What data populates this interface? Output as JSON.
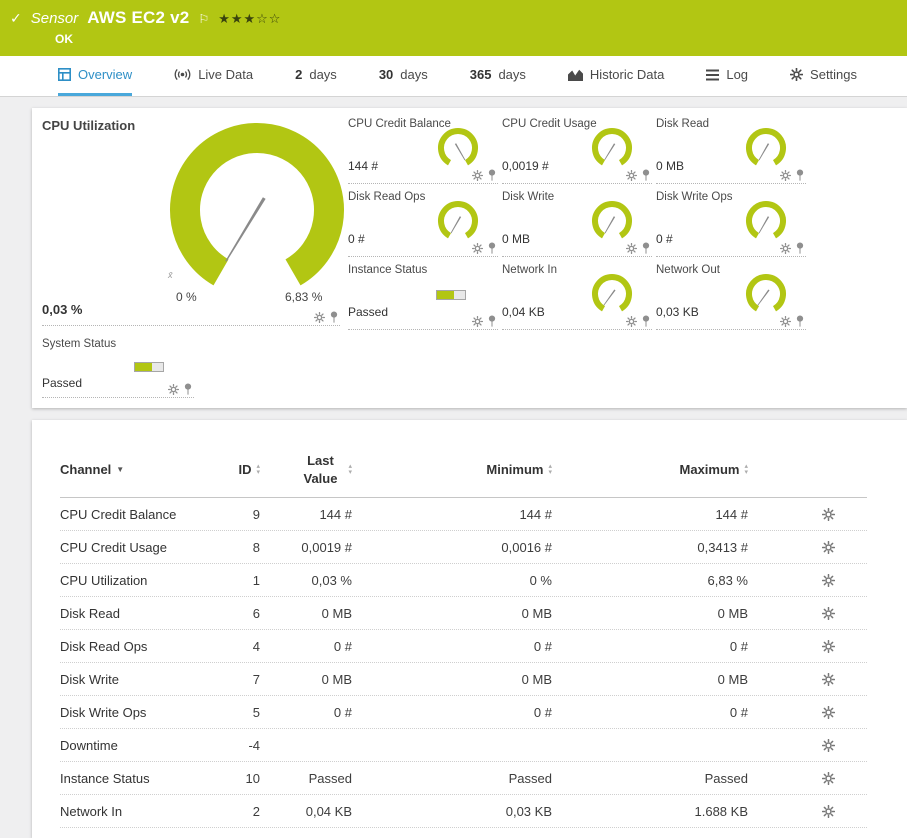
{
  "colors": {
    "green": "#b2c613",
    "green-dark": "#39430e",
    "blue": "#2e8fc6",
    "blue-underline": "#49a8db"
  },
  "icons": {
    "check": "✓",
    "flag": "⚐",
    "sort_desc": "▼",
    "sort_up": "▴",
    "sort_down": "▾"
  },
  "header": {
    "kind_label": "Sensor",
    "title": "AWS EC2 v2",
    "status": "OK",
    "stars_filled": "★★★",
    "stars_empty": "☆☆"
  },
  "tabs": [
    {
      "key": "overview",
      "icon": "overview",
      "label": "Overview",
      "active": true
    },
    {
      "key": "live-data",
      "icon": "livedata",
      "label": "Live Data"
    },
    {
      "key": "2-days",
      "num": "2",
      "label": "days"
    },
    {
      "key": "30-days",
      "num": "30",
      "label": "days"
    },
    {
      "key": "365-days",
      "num": "365",
      "label": "days"
    },
    {
      "key": "historic-data",
      "icon": "historic",
      "label": "Historic Data"
    },
    {
      "key": "log",
      "icon": "log",
      "label": "Log"
    },
    {
      "key": "settings",
      "icon": "settings",
      "label": "Settings"
    }
  ],
  "overview": {
    "main_gauge": {
      "label": "CPU Utilization",
      "value": "0,03 %",
      "min": "0 %",
      "max": "6,83 %",
      "mean_marker": "x̄",
      "needle_fraction": 0.004
    },
    "small_gauges": [
      {
        "label": "CPU Credit Balance",
        "value": "144 #",
        "type": "gauge",
        "needle_fraction": 1
      },
      {
        "label": "CPU Credit Usage",
        "value": "0,0019 #",
        "type": "gauge",
        "needle_fraction": 0.006
      },
      {
        "label": "Disk Read",
        "value": "0 MB",
        "type": "gauge",
        "needle_fraction": 0
      },
      {
        "label": "Disk Read Ops",
        "value": "0 #",
        "type": "gauge",
        "needle_fraction": 0
      },
      {
        "label": "Disk Write",
        "value": "0 MB",
        "type": "gauge",
        "needle_fraction": 0
      },
      {
        "label": "Disk Write Ops",
        "value": "0 #",
        "type": "gauge",
        "needle_fraction": 0
      },
      {
        "label": "Instance Status",
        "value": "Passed",
        "type": "status"
      },
      {
        "label": "Network In",
        "value": "0,04 KB",
        "type": "gauge",
        "needle_fraction": 0.02
      },
      {
        "label": "Network Out",
        "value": "0,03 KB",
        "type": "gauge",
        "needle_fraction": 0.02
      }
    ],
    "system_status": {
      "label": "System Status",
      "value": "Passed",
      "type": "status"
    }
  },
  "table": {
    "headers": {
      "channel": "Channel",
      "id": "ID",
      "last": "Last Value",
      "min": "Minimum",
      "max": "Maximum"
    },
    "rows": [
      {
        "channel": "CPU Credit Balance",
        "id": "9",
        "last": "144 #",
        "min": "144 #",
        "max": "144 #"
      },
      {
        "channel": "CPU Credit Usage",
        "id": "8",
        "last": "0,0019 #",
        "min": "0,0016 #",
        "max": "0,3413 #"
      },
      {
        "channel": "CPU Utilization",
        "id": "1",
        "last": "0,03 %",
        "min": "0 %",
        "max": "6,83 %"
      },
      {
        "channel": "Disk Read",
        "id": "6",
        "last": "0 MB",
        "min": "0 MB",
        "max": "0 MB"
      },
      {
        "channel": "Disk Read Ops",
        "id": "4",
        "last": "0 #",
        "min": "0 #",
        "max": "0 #"
      },
      {
        "channel": "Disk Write",
        "id": "7",
        "last": "0 MB",
        "min": "0 MB",
        "max": "0 MB"
      },
      {
        "channel": "Disk Write Ops",
        "id": "5",
        "last": "0 #",
        "min": "0 #",
        "max": "0 #"
      },
      {
        "channel": "Downtime",
        "id": "-4",
        "last": "",
        "min": "",
        "max": ""
      },
      {
        "channel": "Instance Status",
        "id": "10",
        "last": "Passed",
        "min": "Passed",
        "max": "Passed"
      },
      {
        "channel": "Network In",
        "id": "2",
        "last": "0,04 KB",
        "min": "0,03 KB",
        "max": "1.688 KB"
      }
    ]
  }
}
